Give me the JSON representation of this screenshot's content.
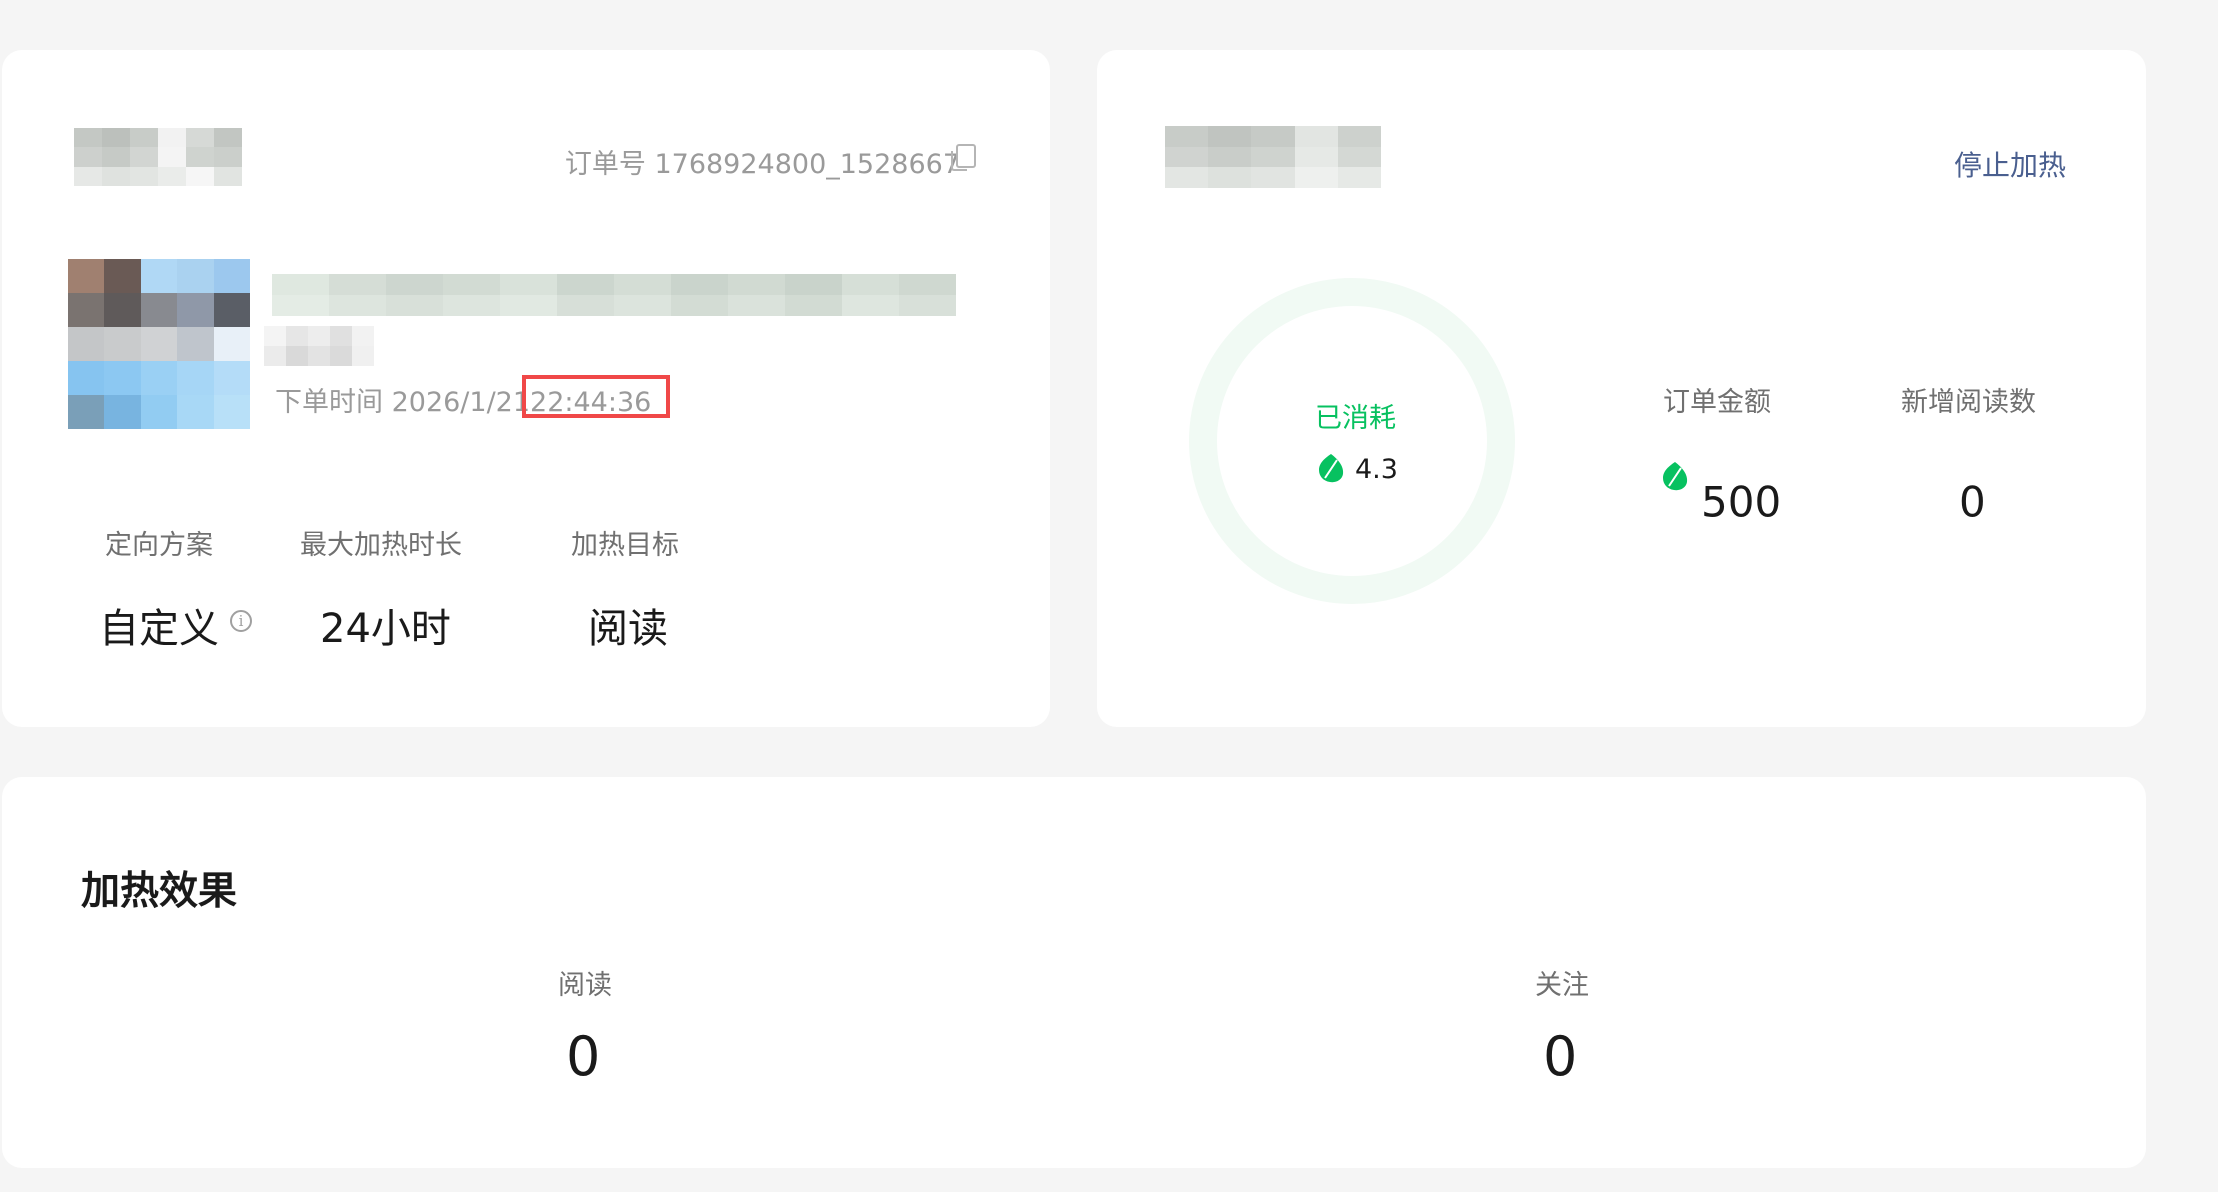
{
  "order_card": {
    "order_no_label": "订单号",
    "order_no": "1768924800_1528667",
    "order_time_label": "下单时间",
    "order_date": "2026/1/21",
    "order_clock": "22:44:36",
    "fields": [
      {
        "label": "定向方案",
        "value": "自定义"
      },
      {
        "label": "最大加热时长",
        "value": "24小时"
      },
      {
        "label": "加热目标",
        "value": "阅读"
      }
    ]
  },
  "stats_card": {
    "stop_label": "停止加热",
    "consumed_label": "已消耗",
    "consumed_value": "4.3",
    "order_amount_label": "订单金额",
    "order_amount_value": "500",
    "new_reads_label": "新增阅读数",
    "new_reads_value": "0"
  },
  "effect_card": {
    "title": "加热效果",
    "metrics": [
      {
        "label": "阅读",
        "value": "0"
      },
      {
        "label": "关注",
        "value": "0"
      }
    ]
  },
  "colors": {
    "accent_green": "#07c160",
    "link_blue": "#4a5f8f",
    "highlight_red": "#f04848"
  },
  "icons": [
    "copy-icon",
    "info-icon",
    "leaf-coin-icon"
  ]
}
